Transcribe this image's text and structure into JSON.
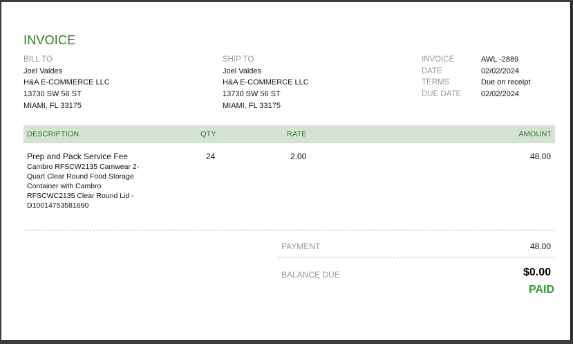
{
  "invoice": {
    "title": "INVOICE",
    "bill_to": {
      "label": "BILL TO",
      "lines": [
        "Joel Valdes",
        "H&A E-COMMERCE LLC",
        "13730 SW 56 ST",
        "MIAMI, FL  33175"
      ]
    },
    "ship_to": {
      "label": "SHIP TO",
      "lines": [
        "Joel Valdes",
        "H&A E-COMMERCE LLC",
        "13730 SW 56 ST",
        "MIAMI, FL  33175"
      ]
    },
    "meta": [
      {
        "label": "INVOICE",
        "value": "AWL -2889"
      },
      {
        "label": "DATE",
        "value": "02/02/2024"
      },
      {
        "label": "TERMS",
        "value": "Due on receipt"
      },
      {
        "label": "DUE DATE",
        "value": "02/02/2024"
      }
    ],
    "table": {
      "headers": {
        "description": "DESCRIPTION",
        "qty": "QTY",
        "rate": "RATE",
        "amount": "AMOUNT"
      },
      "rows": [
        {
          "name": "Prep and Pack Service Fee",
          "description": "Cambro RFSCW2135 Camwear 2-Quart Clear Round Food Storage Container with Cambro RFSCWC2135 Clear Round Lid - D10014753581690",
          "qty": "24",
          "rate": "2.00",
          "amount": "48.00"
        }
      ]
    },
    "summary": {
      "payment_label": "PAYMENT",
      "payment_value": "48.00",
      "balance_label": "BALANCE DUE",
      "balance_value": "$0.00",
      "status": "PAID"
    },
    "colors": {
      "accent": "#2f7a2b",
      "header_bg": "#d5e3d4",
      "paid": "#2e9e3a"
    }
  }
}
